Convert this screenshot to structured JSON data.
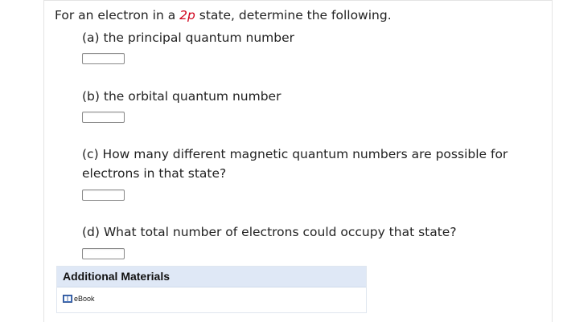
{
  "question": {
    "prefix": "For an electron in a ",
    "state": "2p",
    "suffix": " state, determine the following."
  },
  "parts": [
    {
      "label": "(a) the principal quantum number",
      "answer": ""
    },
    {
      "label": "(b) the orbital quantum number",
      "answer": ""
    },
    {
      "label": "(c) How many different magnetic quantum numbers are possible for electrons in that state?",
      "answer": ""
    },
    {
      "label": "(d) What total number of electrons could occupy that state?",
      "answer": ""
    }
  ],
  "materials": {
    "title": "Additional Materials",
    "ebook_label": "eBook",
    "ebook_icon": "book-icon"
  },
  "colors": {
    "highlight": "#d0021b",
    "materials_header_bg": "#dfe8f6"
  }
}
